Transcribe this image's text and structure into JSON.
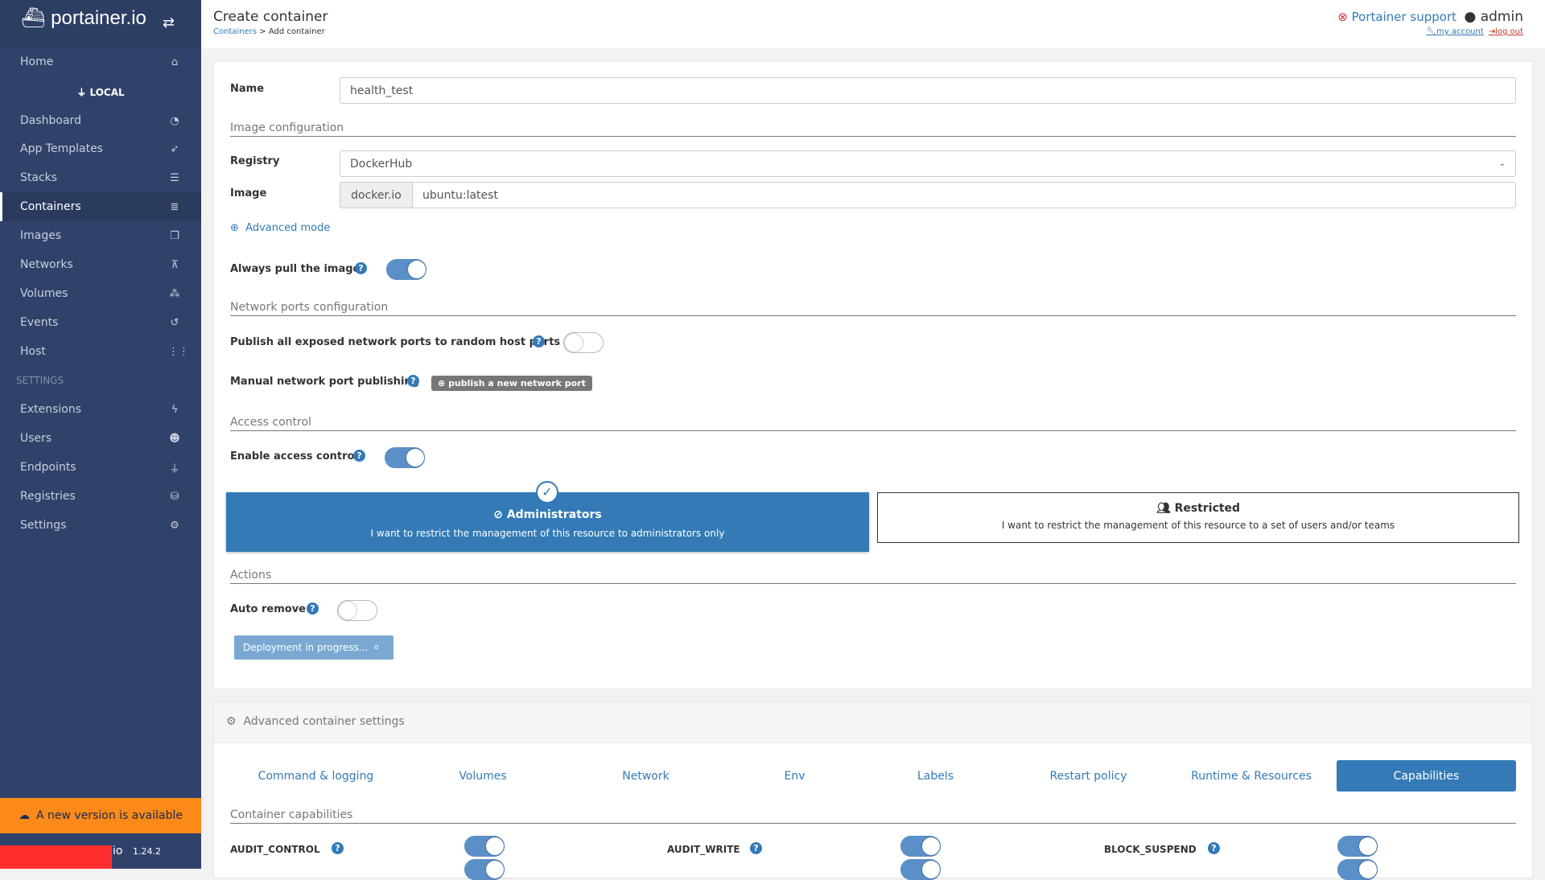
{
  "sidebar": {
    "brand": "portainer.io",
    "home": "Home",
    "endpoint": "LOCAL",
    "items": [
      {
        "label": "Dashboard",
        "icon": "tachometer-icon"
      },
      {
        "label": "App Templates",
        "icon": "rocket-icon"
      },
      {
        "label": "Stacks",
        "icon": "th-list-icon"
      },
      {
        "label": "Containers",
        "icon": "server-icon",
        "active": true
      },
      {
        "label": "Images",
        "icon": "clone-icon"
      },
      {
        "label": "Networks",
        "icon": "sitemap-icon"
      },
      {
        "label": "Volumes",
        "icon": "cubes-icon"
      },
      {
        "label": "Events",
        "icon": "history-icon"
      },
      {
        "label": "Host",
        "icon": "th-icon"
      }
    ],
    "settings_heading": "SETTINGS",
    "settings_items": [
      {
        "label": "Extensions",
        "icon": "bolt-icon"
      },
      {
        "label": "Users",
        "icon": "users-icon"
      },
      {
        "label": "Endpoints",
        "icon": "plug-icon"
      },
      {
        "label": "Registries",
        "icon": "database-icon"
      },
      {
        "label": "Settings",
        "icon": "cogs-icon"
      }
    ],
    "update_banner": "A new version is available",
    "footer_brand": "io",
    "version": "1.24.2"
  },
  "header": {
    "title": "Create container",
    "breadcrumb_link": "Containers",
    "breadcrumb_current": "> Add container",
    "support": "Portainer support",
    "user": "admin",
    "my_account": "my account",
    "log_out": "log out"
  },
  "form": {
    "name_label": "Name",
    "name_value": "health_test",
    "image_section": "Image configuration",
    "registry_label": "Registry",
    "registry_value": "DockerHub",
    "image_label": "Image",
    "image_prefix": "docker.io",
    "image_value": "ubuntu:latest",
    "advanced_mode": "Advanced mode",
    "always_pull_label": "Always pull the image",
    "always_pull": true,
    "network_section": "Network ports configuration",
    "publish_all_label": "Publish all exposed network ports to random host ports",
    "publish_all": false,
    "manual_label": "Manual network port publishing",
    "publish_button": "publish a new network port",
    "access_section": "Access control",
    "enable_access_label": "Enable access control",
    "enable_access": true,
    "admin_title": "Administrators",
    "admin_desc": "I want to restrict the management of this resource to administrators only",
    "restricted_title": "Restricted",
    "restricted_desc": "I want to restrict the management of this resource to a set of users and/or teams",
    "actions_section": "Actions",
    "auto_remove_label": "Auto remove",
    "auto_remove": false,
    "deploy_button": "Deployment in progress..."
  },
  "advanced": {
    "title": "Advanced container settings",
    "tabs": [
      "Command & logging",
      "Volumes",
      "Network",
      "Env",
      "Labels",
      "Restart policy",
      "Runtime & Resources",
      "Capabilities"
    ],
    "active_tab": "Capabilities",
    "cap_section": "Container capabilities",
    "caps": [
      {
        "name": "AUDIT_CONTROL",
        "on": true
      },
      {
        "name": "AUDIT_WRITE",
        "on": true
      },
      {
        "name": "BLOCK_SUSPEND",
        "on": true
      }
    ]
  },
  "colors": {
    "sidebar": "#30426a",
    "accent": "#337ab7",
    "update": "#fb8a1a"
  }
}
